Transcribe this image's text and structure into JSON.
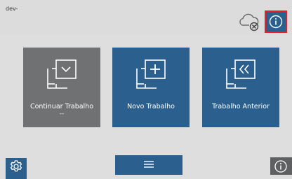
{
  "header": {
    "label": "dev-"
  },
  "tiles": [
    {
      "label": "Continuar Trabalho",
      "sublabel": "--",
      "icon": "window-chevron-down-icon",
      "color": "#6f7172"
    },
    {
      "label": "Novo Trabalho",
      "icon": "window-plus-icon",
      "color": "#2b5f8d"
    },
    {
      "label": "Trabalho Anterior",
      "icon": "window-double-chevron-left-icon",
      "color": "#2b5f8d"
    }
  ],
  "colors": {
    "accent": "#2b5f8d",
    "disabled_tile": "#6f7172",
    "highlight_border": "#e0212b",
    "background": "#dededf"
  }
}
